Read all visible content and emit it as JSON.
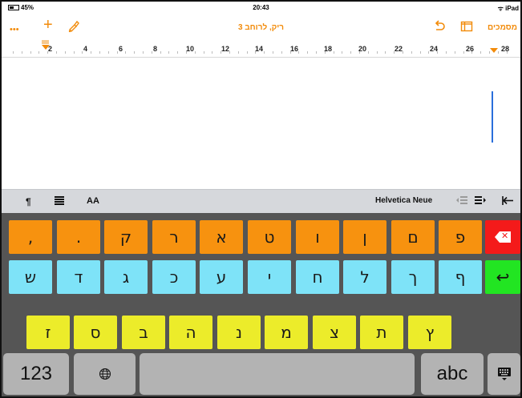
{
  "status_bar": {
    "battery": "45%",
    "time": "20:43",
    "device": "iPad"
  },
  "toolbar": {
    "more_label": "•••",
    "add_label": "+",
    "title": "ריק, לרוחב 3",
    "documents_label": "מסמכים"
  },
  "ruler": {
    "numbers": [
      "2",
      "4",
      "6",
      "8",
      "10",
      "12",
      "14",
      "16",
      "18",
      "20",
      "22",
      "24",
      "26",
      "28"
    ]
  },
  "format_bar": {
    "paragraph_symbol": "¶",
    "text_size_label": "AA",
    "font_name": "Helvetica Neue"
  },
  "keyboard": {
    "row1": [
      ",",
      ".",
      "ק",
      "ר",
      "א",
      "ט",
      "ו",
      "ן",
      "ם",
      "פ"
    ],
    "row2": [
      "ש",
      "ד",
      "ג",
      "כ",
      "ע",
      "י",
      "ח",
      "ל",
      "ך",
      "ף"
    ],
    "row3": [
      "ז",
      "ס",
      "ב",
      "ה",
      "נ",
      "מ",
      "צ",
      "ת",
      "ץ"
    ],
    "numbers_label": "123",
    "letters_label": "abc",
    "return_symbol": "↩",
    "globe_symbol": "🌐",
    "colors": {
      "punctuation": "#f7920f",
      "consonant_row2": "#7ee3f8",
      "consonant_row3": "#ecec2a",
      "delete": "#f41a1a",
      "return": "#22e522"
    }
  }
}
